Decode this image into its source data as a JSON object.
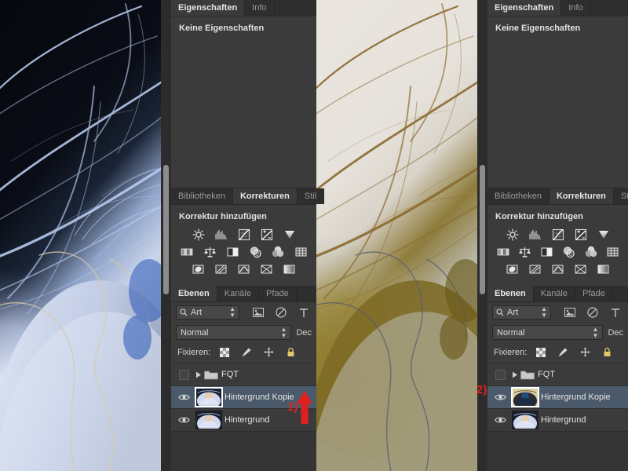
{
  "app": "Adobe Photoshop",
  "annotations": [
    {
      "name": "step-1",
      "label": "1)",
      "color": "#e02020"
    },
    {
      "name": "step-2",
      "label": "2)",
      "color": "#e02020"
    }
  ],
  "properties_panel": {
    "tabs": [
      {
        "label": "Eigenschaften",
        "active": true
      },
      {
        "label": "Info",
        "active": false
      }
    ],
    "empty_message": "Keine Eigenschaften"
  },
  "corrections_panel": {
    "tabs": [
      {
        "label": "Bibliotheken",
        "active": false
      },
      {
        "label": "Korrekturen",
        "active": true
      },
      {
        "label": "Stil",
        "active": false
      }
    ],
    "title": "Korrektur hinzufügen",
    "icon_rows": [
      [
        "brightness-contrast-icon",
        "levels-icon",
        "curves-icon",
        "exposure-icon",
        "vibrance-icon"
      ],
      [
        "hue-saturation-icon",
        "color-balance-icon",
        "black-white-icon",
        "photo-filter-icon",
        "channel-mixer-icon",
        "color-lookup-icon"
      ],
      [
        "invert-icon",
        "posterize-icon",
        "threshold-icon",
        "gradient-map-icon",
        "selective-color-icon"
      ]
    ]
  },
  "layers_panel": {
    "tabs": [
      {
        "label": "Ebenen",
        "active": true
      },
      {
        "label": "Kanäle",
        "active": false
      },
      {
        "label": "Pfade",
        "active": false
      }
    ],
    "filter": {
      "value": "Art",
      "icon": "search-icon"
    },
    "filter_icons": [
      "image-filter-icon",
      "adjustment-filter-icon",
      "type-filter-icon"
    ],
    "blend_mode": "Normal",
    "opacity_label": "Dec",
    "lock_label": "Fixieren:",
    "lock_icons": [
      "lock-transparency-icon",
      "lock-image-icon",
      "lock-position-icon",
      "lock-all-icon"
    ],
    "rows": [
      {
        "name": "FQT",
        "type": "group",
        "visible": false,
        "selected": false,
        "expanded": false,
        "thumb": "none"
      },
      {
        "name": "Hintergrund Kopie",
        "type": "layer",
        "visible": true,
        "selected": true,
        "thumb": "portrait"
      },
      {
        "name": "Hintergrund",
        "type": "layer",
        "visible": true,
        "selected": false,
        "thumb": "portrait"
      }
    ]
  },
  "layers_panel_right": {
    "rows": [
      {
        "name": "FQT",
        "type": "group",
        "visible": false,
        "selected": false,
        "expanded": false,
        "thumb": "none"
      },
      {
        "name": "Hintergrund Kopie",
        "type": "layer",
        "visible": true,
        "selected": true,
        "thumb": "inverted"
      },
      {
        "name": "Hintergrund",
        "type": "layer",
        "visible": true,
        "selected": false,
        "thumb": "portrait"
      }
    ]
  },
  "canvas": {
    "left_image": {
      "name": "inverted-hair-portrait",
      "description": "Inverted negative of a hair portrait: blue and white strands on black"
    },
    "middle_image": {
      "name": "normal-hair-portrait",
      "description": "Normal hair portrait: brown strands on light background"
    }
  },
  "colors": {
    "panel_bg": "#3b3b3b",
    "tab_bg": "#2e2e2e",
    "selected_layer": "#4b5a6b",
    "annotation": "#e02020",
    "text": "#e2e2e2"
  }
}
